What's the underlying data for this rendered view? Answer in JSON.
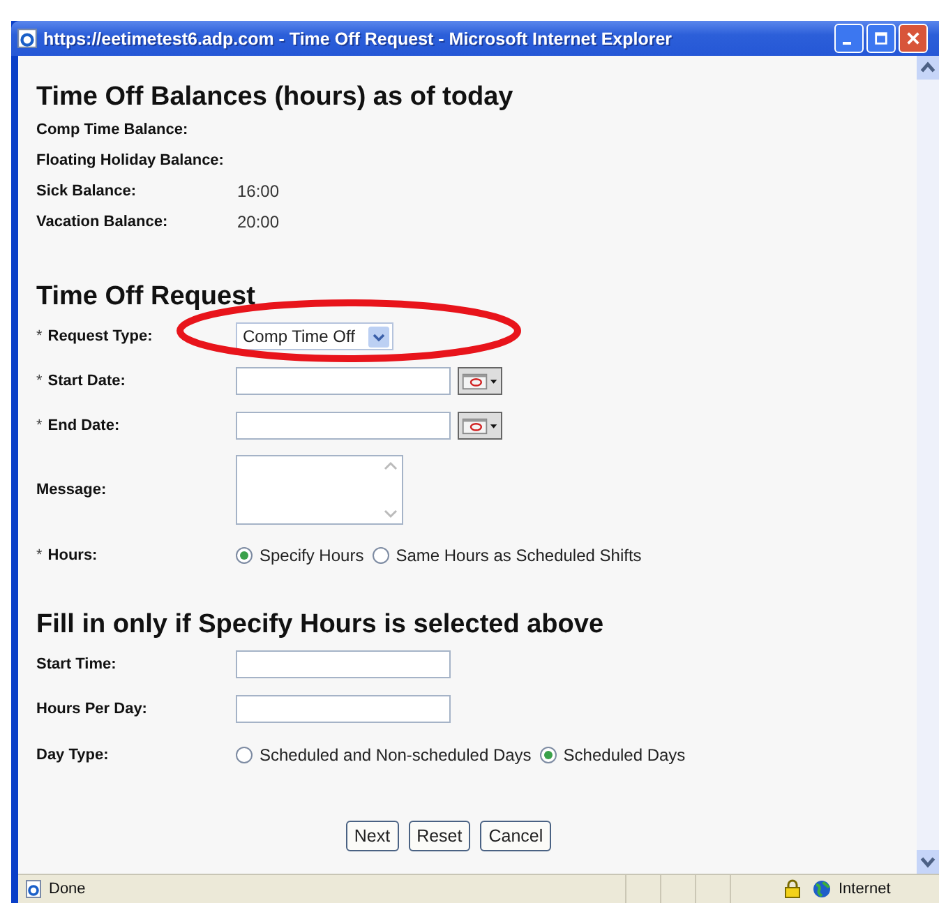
{
  "window": {
    "title": "https://eetimetest6.adp.com - Time Off Request - Microsoft Internet Explorer"
  },
  "balances": {
    "heading": "Time Off Balances (hours) as of today",
    "rows": [
      {
        "label": "Comp Time Balance:"
      },
      {
        "label": "Floating Holiday Balance:"
      },
      {
        "label": "Sick Balance:",
        "value": "16:00"
      },
      {
        "label": "Vacation Balance:",
        "value": "20:00"
      }
    ]
  },
  "request": {
    "heading": "Time Off Request",
    "fields": [
      {
        "kind": "select",
        "required_mark": "*",
        "label": "Request Type:",
        "value": "Comp Time Off"
      },
      {
        "kind": "date",
        "required_mark": "*",
        "label": "Start Date:"
      },
      {
        "kind": "date",
        "required_mark": "*",
        "label": "End Date:"
      },
      {
        "kind": "textarea",
        "label": "Message:"
      },
      {
        "kind": "radio",
        "required_mark": "*",
        "label": "Hours:",
        "options": [
          {
            "label": "Specify Hours",
            "selected": true
          },
          {
            "label": "Same Hours as Scheduled Shifts",
            "selected": false
          }
        ]
      }
    ]
  },
  "optional": {
    "heading": "Fill in only if Specify Hours is selected above",
    "fields": [
      {
        "kind": "text",
        "label": "Start Time:"
      },
      {
        "kind": "text",
        "label": "Hours Per Day:"
      },
      {
        "kind": "radio",
        "label": "Day Type:",
        "options": [
          {
            "label": "Scheduled and Non-scheduled Days",
            "selected": false
          },
          {
            "label": "Scheduled Days",
            "selected": true
          }
        ]
      }
    ]
  },
  "buttons": [
    "Next",
    "Reset",
    "Cancel"
  ],
  "annotation": {
    "kind": "ellipse"
  },
  "status_bar": {
    "text": "Done",
    "secure": true,
    "zone": "Internet"
  }
}
